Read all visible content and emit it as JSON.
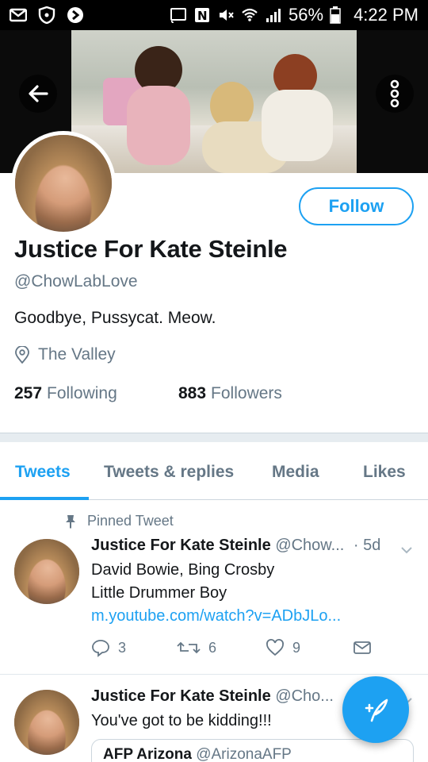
{
  "status_bar": {
    "battery": "56%",
    "time": "4:22 PM"
  },
  "profile": {
    "display_name": "Justice For Kate Steinle",
    "handle": "@ChowLabLove",
    "bio": "Goodbye, Pussycat. Meow.",
    "location": "The Valley",
    "following_count": "257",
    "following_label": "Following",
    "followers_count": "883",
    "followers_label": "Followers",
    "follow_button": "Follow"
  },
  "tabs": [
    {
      "label": "Tweets",
      "active": true
    },
    {
      "label": "Tweets & replies",
      "active": false
    },
    {
      "label": "Media",
      "active": false
    },
    {
      "label": "Likes",
      "active": false
    }
  ],
  "tweets": [
    {
      "pinned_label": "Pinned Tweet",
      "name": "Justice For Kate Steinle",
      "handle": "@Chow...",
      "time": "· 5d",
      "line1": "David Bowie, Bing Crosby",
      "line2": "Little Drummer Boy",
      "link": "m.youtube.com/watch?v=ADbJLo...",
      "replies": "3",
      "retweets": "6",
      "likes": "9"
    },
    {
      "name": "Justice For Kate Steinle",
      "handle": "@Cho...",
      "text": "You've got to be kidding!!!",
      "quote_name": "AFP Arizona",
      "quote_handle": "@ArizonaAFP"
    }
  ],
  "colors": {
    "accent": "#1da1f2",
    "muted": "#657786",
    "text": "#14171a"
  },
  "icons": [
    "back-arrow-icon",
    "more-vertical-icon",
    "location-pin-icon",
    "pin-icon",
    "reply-icon",
    "retweet-icon",
    "like-icon",
    "dm-icon",
    "chevron-down-icon",
    "compose-icon"
  ]
}
